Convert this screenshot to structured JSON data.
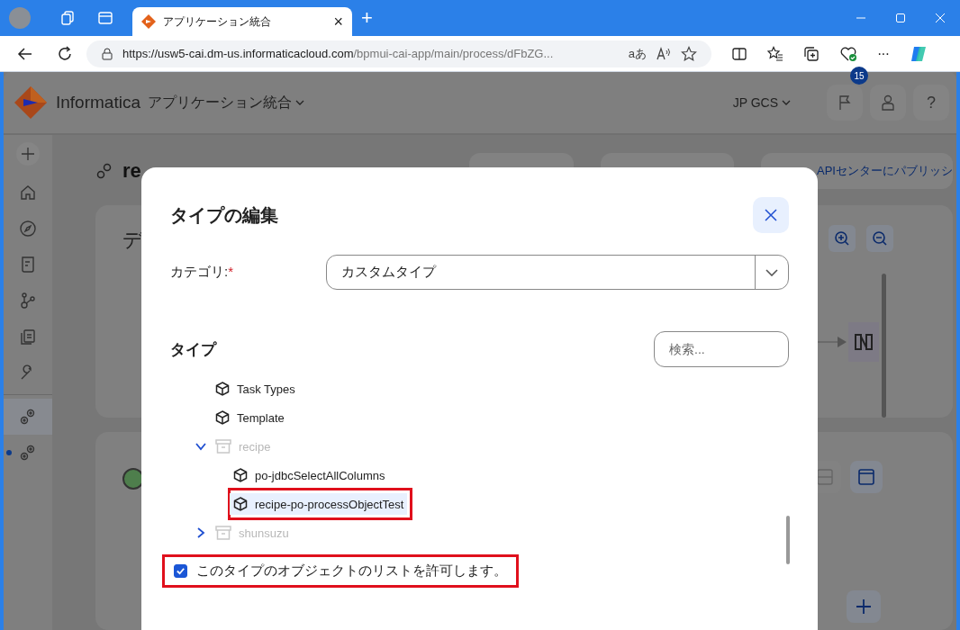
{
  "browser": {
    "tab": {
      "title": "アプリケーション統合",
      "close": "×"
    },
    "new_tab": "+",
    "address": {
      "host": "https://usw5-cai.dm-us.informaticacloud.com",
      "path": "/bpmui-cai-app/main/process/dFbZG..."
    },
    "translate": "aあ",
    "more": "···"
  },
  "app": {
    "brand": "Informatica",
    "product": "アプリケーション統合",
    "org": "JP GCS",
    "notification_count": "15",
    "help": "?",
    "sidebar": [
      {
        "kind": "home",
        "selected": false,
        "modified": false
      },
      {
        "kind": "explore",
        "selected": false,
        "modified": false
      },
      {
        "kind": "monitor",
        "selected": false,
        "modified": false
      },
      {
        "kind": "graph",
        "selected": false,
        "modified": false
      },
      {
        "kind": "library",
        "selected": false,
        "modified": false
      },
      {
        "kind": "tools",
        "selected": false,
        "modified": false
      },
      {
        "kind": "process",
        "selected": true,
        "modified": false
      },
      {
        "kind": "process",
        "selected": false,
        "modified": true
      }
    ],
    "page_title": "re",
    "panel_title": "デ",
    "publish": "APIセンターにパブリッシ"
  },
  "dialog": {
    "title": "タイプの編集",
    "category_label": "カテゴリ:",
    "required_mark": "*",
    "category": "カスタムタイプ",
    "type_label": "タイプ",
    "search": {
      "placeholder": "検索..."
    },
    "tree": [
      {
        "label": "Task Types",
        "kind": "type",
        "selected": false,
        "highlighted": false
      },
      {
        "label": "Template",
        "kind": "type",
        "selected": false,
        "highlighted": false
      },
      {
        "label": "recipe",
        "kind": "folder",
        "expanded": true,
        "children": [
          {
            "label": "po-jdbcSelectAllColumns",
            "kind": "type",
            "selected": false,
            "highlighted": false
          },
          {
            "label": "recipe-po-processObjectTest",
            "kind": "type",
            "selected": true,
            "highlighted": true
          }
        ]
      },
      {
        "label": "shunsuzu",
        "kind": "folder",
        "expanded": false
      }
    ],
    "allow_list": {
      "label": "このタイプのオブジェクトのリストを許可します。",
      "checked": true,
      "highlighted": true
    }
  }
}
